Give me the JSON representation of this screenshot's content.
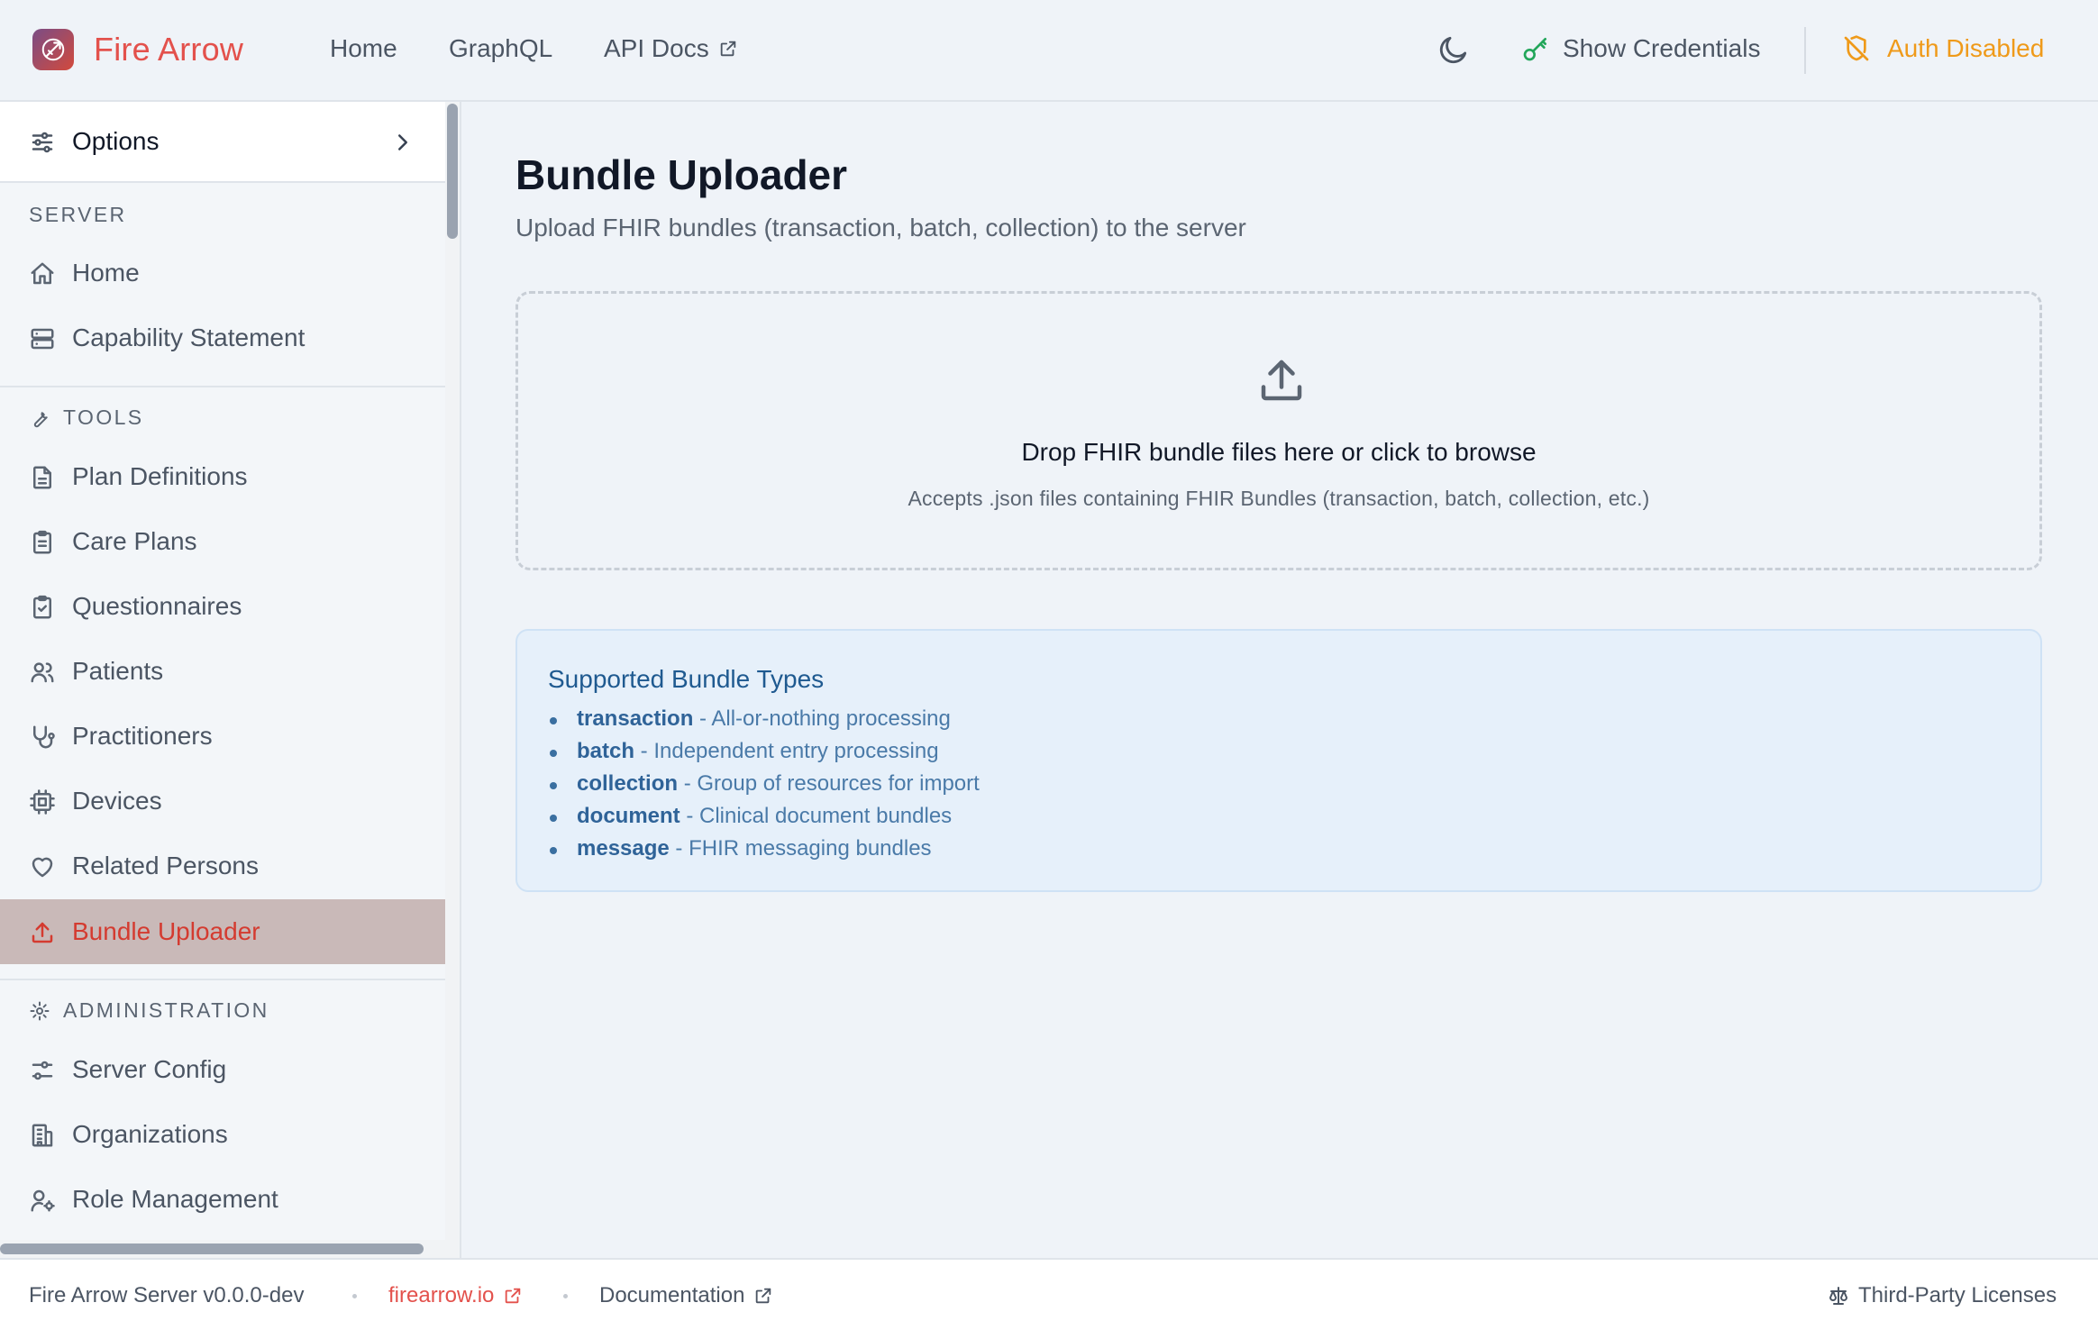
{
  "header": {
    "brand": "Fire Arrow",
    "nav": [
      {
        "label": "Home"
      },
      {
        "label": "GraphQL"
      },
      {
        "label": "API Docs"
      }
    ],
    "show_credentials": "Show Credentials",
    "auth_status": "Auth Disabled",
    "colors": {
      "brand": "#e3514c",
      "auth": "#ef9a1a",
      "credentials_icon": "#22a65a"
    }
  },
  "sidebar": {
    "options_label": "Options",
    "server_header": "SERVER",
    "server_items": [
      {
        "label": "Home",
        "icon": "home-icon"
      },
      {
        "label": "Capability Statement",
        "icon": "server-icon"
      }
    ],
    "tools_header": "TOOLS",
    "tools_items": [
      {
        "label": "Plan Definitions",
        "icon": "file-text-icon"
      },
      {
        "label": "Care Plans",
        "icon": "clipboard-list-icon"
      },
      {
        "label": "Questionnaires",
        "icon": "clipboard-check-icon"
      },
      {
        "label": "Patients",
        "icon": "users-icon"
      },
      {
        "label": "Practitioners",
        "icon": "stethoscope-icon"
      },
      {
        "label": "Devices",
        "icon": "cpu-icon"
      },
      {
        "label": "Related Persons",
        "icon": "heart-icon"
      },
      {
        "label": "Bundle Uploader",
        "icon": "upload-icon",
        "active": true
      }
    ],
    "admin_header": "ADMINISTRATION",
    "admin_items": [
      {
        "label": "Server Config",
        "icon": "sliders-icon"
      },
      {
        "label": "Organizations",
        "icon": "building-icon"
      },
      {
        "label": "Role Management",
        "icon": "user-cog-icon"
      }
    ],
    "active_color": "#d43b30"
  },
  "main": {
    "title": "Bundle Uploader",
    "subtitle": "Upload FHIR bundles (transaction, batch, collection) to the server",
    "dropzone": {
      "title": "Drop FHIR bundle files here or click to browse",
      "subtitle": "Accepts .json files containing FHIR Bundles (transaction, batch, collection, etc.)"
    },
    "info": {
      "title": "Supported Bundle Types",
      "items": [
        {
          "name": "transaction",
          "desc": " - All-or-nothing processing"
        },
        {
          "name": "batch",
          "desc": " - Independent entry processing"
        },
        {
          "name": "collection",
          "desc": " - Group of resources for import"
        },
        {
          "name": "document",
          "desc": " - Clinical document bundles"
        },
        {
          "name": "message",
          "desc": " - FHIR messaging bundles"
        }
      ]
    }
  },
  "footer": {
    "version": "Fire Arrow Server v0.0.0-dev",
    "website": "firearrow.io",
    "docs": "Documentation",
    "licenses": "Third-Party Licenses"
  }
}
